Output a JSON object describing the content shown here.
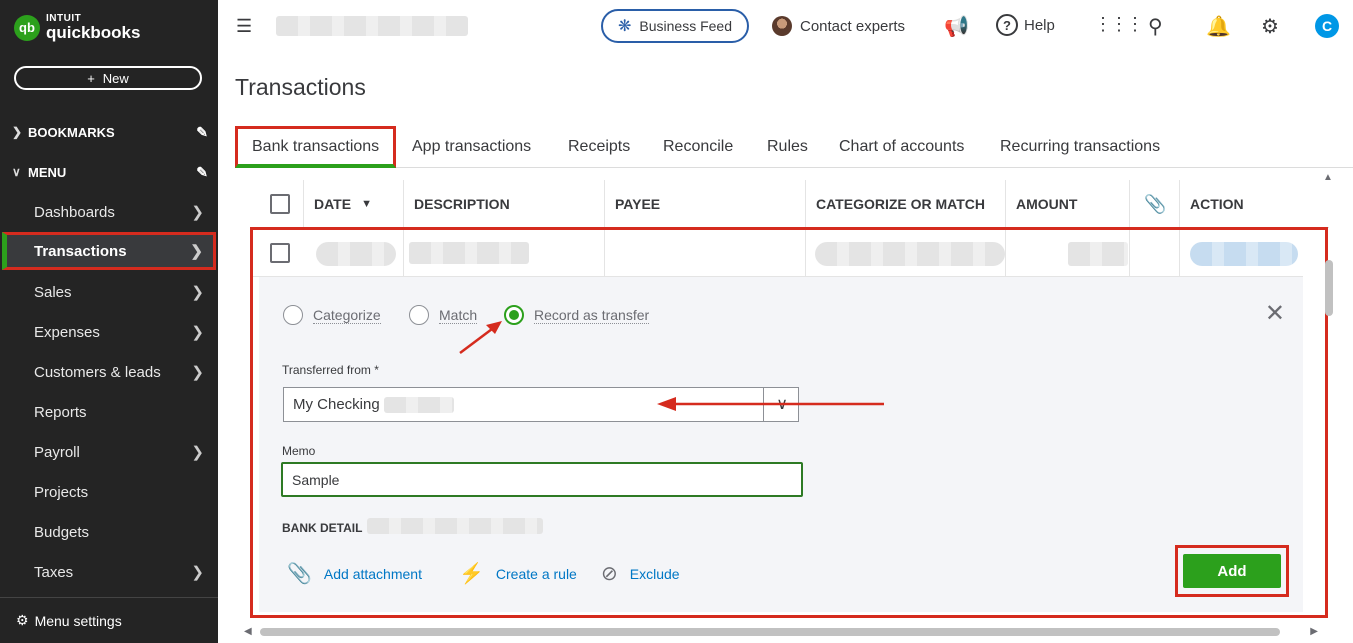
{
  "sidebar": {
    "logo_line1": "INTUIT",
    "logo_line2": "quickbooks",
    "logo_badge": "qb",
    "new_label": "New",
    "bookmarks_label": "BOOKMARKS",
    "menu_label": "MENU",
    "items": [
      {
        "label": "Dashboards",
        "arrow": true
      },
      {
        "label": "Transactions",
        "arrow": true,
        "active": true
      },
      {
        "label": "Sales",
        "arrow": true
      },
      {
        "label": "Expenses",
        "arrow": true
      },
      {
        "label": "Customers & leads",
        "arrow": true
      },
      {
        "label": "Reports",
        "arrow": false
      },
      {
        "label": "Payroll",
        "arrow": true
      },
      {
        "label": "Projects",
        "arrow": false
      },
      {
        "label": "Budgets",
        "arrow": false
      },
      {
        "label": "Taxes",
        "arrow": true
      }
    ],
    "menu_settings_label": "Menu settings"
  },
  "topbar": {
    "business_feed_label": "Business Feed",
    "contact_label": "Contact experts",
    "help_label": "Help",
    "user_initial": "C"
  },
  "page": {
    "title": "Transactions",
    "tabs": [
      {
        "label": "Bank transactions",
        "active": true
      },
      {
        "label": "App transactions"
      },
      {
        "label": "Receipts"
      },
      {
        "label": "Reconcile"
      },
      {
        "label": "Rules"
      },
      {
        "label": "Chart of accounts"
      },
      {
        "label": "Recurring transactions"
      }
    ]
  },
  "table": {
    "columns": {
      "date": "DATE",
      "description": "DESCRIPTION",
      "payee": "PAYEE",
      "categorize": "CATEGORIZE OR MATCH",
      "amount": "AMOUNT",
      "action": "ACTION"
    }
  },
  "panel": {
    "radio_categorize": "Categorize",
    "radio_match": "Match",
    "radio_transfer": "Record as transfer",
    "transferred_from_label": "Transferred from *",
    "transferred_from_value": "My Checking",
    "memo_label": "Memo",
    "memo_value": "Sample",
    "bank_detail_label": "BANK DETAIL",
    "add_attachment": "Add attachment",
    "create_rule": "Create a rule",
    "exclude": "Exclude",
    "add_label": "Add"
  },
  "colors": {
    "brand_green": "#2ca01c",
    "sidebar_bg": "#242424",
    "link_blue": "#0077c5",
    "highlight_red": "#d52b1e"
  }
}
